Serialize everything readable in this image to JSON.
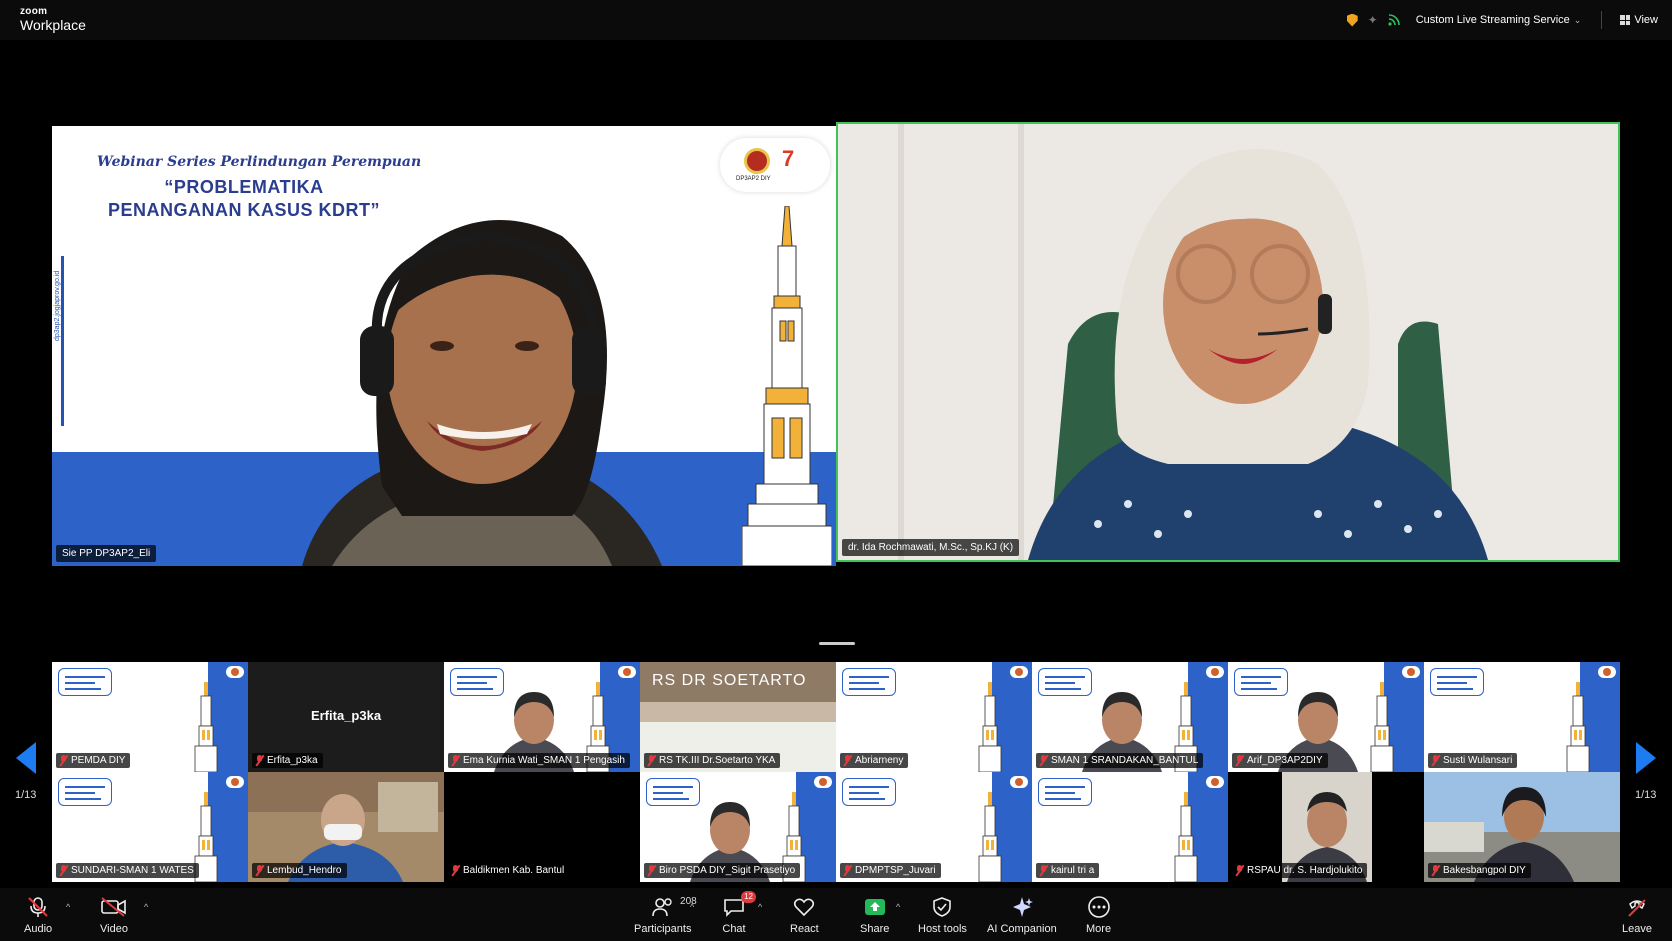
{
  "app": {
    "brand_small": "zoom",
    "brand_name": "Workplace"
  },
  "topbar": {
    "stream_label": "Custom Live Streaming Service",
    "view_label": "View",
    "icons": [
      "shield-icon",
      "sparkle-icon",
      "live-stream-icon",
      "grid-view-icon"
    ]
  },
  "main": {
    "left_tile": {
      "slide_title_line1": "Webinar Series Perlindungan Perempuan",
      "slide_title_line2": "“PROBLEMATIKA",
      "slide_title_line3": "PENANGANAN KASUS KDRT”",
      "logo_text": "DP3AP2 DIY",
      "url_text": "dp3ap2.jogjaprov.go.id",
      "participant": "Sie PP DP3AP2_Eli"
    },
    "right_tile": {
      "participant": "dr. Ida Rochmawati, M.Sc., Sp.KJ (K)",
      "active_speaker_color": "#3fc35a"
    }
  },
  "gallery": {
    "page_left": "1/13",
    "page_right": "1/13",
    "rows": [
      [
        {
          "name": "PEMDA DIY",
          "type": "slide"
        },
        {
          "name": "Erfita_p3ka",
          "type": "name",
          "center": "Erfita_p3ka"
        },
        {
          "name": "Ema Kurnia Wati_SMAN 1 Pengasih",
          "type": "slide-person"
        },
        {
          "name": "RS TK.III Dr.Soetarto YKA",
          "type": "room",
          "sign": "RS DR SOETARTO"
        },
        {
          "name": "Abriarneny",
          "type": "slide"
        },
        {
          "name": "SMAN 1 SRANDAKAN_BANTUL",
          "type": "slide-person"
        },
        {
          "name": "Arif_DP3AP2DIY",
          "type": "slide-person"
        },
        {
          "name": "Susti Wulansari",
          "type": "slide"
        }
      ],
      [
        {
          "name": "SUNDARI-SMAN 1 WATES",
          "type": "slide"
        },
        {
          "name": "Lembud_Hendro",
          "type": "office"
        },
        {
          "name": "Baldikmen Kab. Bantul",
          "type": "black"
        },
        {
          "name": "Biro PSDA DIY_Sigit Prasetiyo",
          "type": "slide-person"
        },
        {
          "name": "DPMPTSP_Juvari",
          "type": "slide"
        },
        {
          "name": "kairul tri a",
          "type": "slide"
        },
        {
          "name": "RSPAU dr. S. Hardjolukito",
          "type": "person-dark"
        },
        {
          "name": "Bakesbangpol DIY",
          "type": "outdoor"
        }
      ]
    ]
  },
  "toolbar": {
    "audio": "Audio",
    "video": "Video",
    "participants": "Participants",
    "participants_count": "208",
    "chat": "Chat",
    "chat_badge": "12",
    "react": "React",
    "share": "Share",
    "host_tools": "Host tools",
    "ai_companion": "AI Companion",
    "more": "More",
    "leave": "Leave"
  }
}
